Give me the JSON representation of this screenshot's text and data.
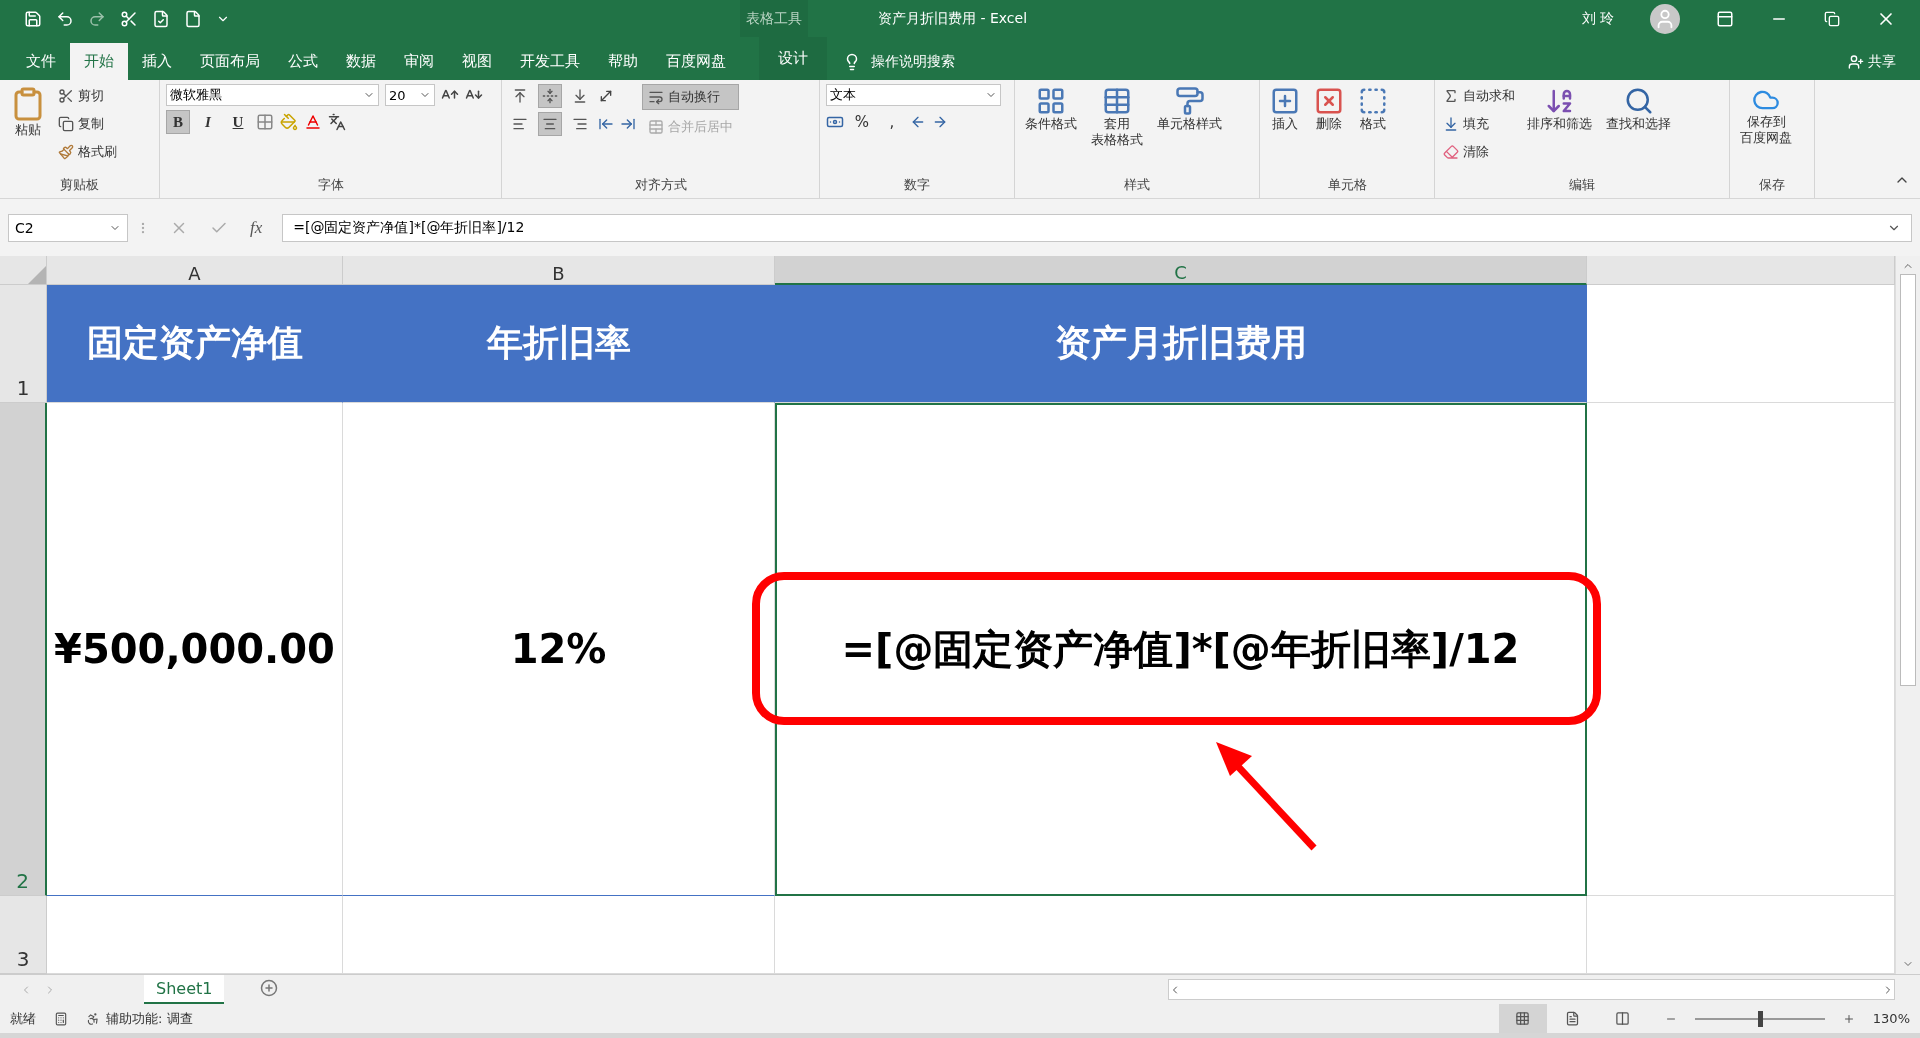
{
  "title_bar": {
    "context_group": "表格工具",
    "document_title": "资产月折旧费用 - Excel",
    "user": "刘 玲"
  },
  "menu_tabs": [
    {
      "label": "文件",
      "selected": false
    },
    {
      "label": "开始",
      "selected": true
    },
    {
      "label": "插入",
      "selected": false
    },
    {
      "label": "页面布局",
      "selected": false
    },
    {
      "label": "公式",
      "selected": false
    },
    {
      "label": "数据",
      "selected": false
    },
    {
      "label": "审阅",
      "selected": false
    },
    {
      "label": "视图",
      "selected": false
    },
    {
      "label": "开发工具",
      "selected": false
    },
    {
      "label": "帮助",
      "selected": false
    },
    {
      "label": "百度网盘",
      "selected": false
    }
  ],
  "context_tab": {
    "label": "设计",
    "selected": false
  },
  "tell_me": "操作说明搜索",
  "share": "共享",
  "ribbon": {
    "clipboard": {
      "label": "剪贴板",
      "paste": "粘贴",
      "cut": "剪切",
      "copy": "复制",
      "format_painter": "格式刷"
    },
    "font": {
      "label": "字体",
      "font_name": "微软雅黑",
      "font_size": "20",
      "styles": [
        {
          "label": "B",
          "selected": true
        },
        {
          "label": "I",
          "selected": false
        },
        {
          "label": "U",
          "selected": false
        }
      ]
    },
    "alignment": {
      "label": "对齐方式",
      "vertical": [
        {
          "kind": "top",
          "selected": false
        },
        {
          "kind": "middle",
          "selected": true
        },
        {
          "kind": "bottom",
          "selected": false
        }
      ],
      "horizontal": [
        {
          "kind": "left",
          "selected": false
        },
        {
          "kind": "center",
          "selected": true
        },
        {
          "kind": "right",
          "selected": false
        }
      ],
      "wrap_text": {
        "label": "自动换行",
        "selected": true
      },
      "merge": {
        "label": "合并后居中",
        "disabled": true
      }
    },
    "number": {
      "label": "数字",
      "format": "文本",
      "percent": "%",
      "comma": ","
    },
    "styles": {
      "label": "样式",
      "items": [
        {
          "lines": [
            "条件格式"
          ]
        },
        {
          "lines": [
            "套用",
            "表格格式"
          ]
        },
        {
          "lines": [
            "单元格样式"
          ]
        }
      ]
    },
    "cells": {
      "label": "单元格",
      "items": [
        "插入",
        "删除",
        "格式"
      ]
    },
    "editing": {
      "label": "编辑",
      "autosum": "自动求和",
      "fill": "填充",
      "clear": "清除",
      "sort": "排序和筛选",
      "find": "查找和选择"
    },
    "save": {
      "label": "保存",
      "lines": [
        "保存到",
        "百度网盘"
      ]
    }
  },
  "name_box": "C2",
  "fx": "fx",
  "formula": "=[@固定资产净值]*[@年折旧率]/12",
  "columns": [
    {
      "label": "A",
      "selected": false
    },
    {
      "label": "B",
      "selected": false
    },
    {
      "label": "C",
      "selected": true
    }
  ],
  "rows": [
    {
      "number": "1",
      "kind": "header",
      "selected": false,
      "cells": [
        "固定资产净值",
        "年折旧率",
        "资产月折旧费用"
      ]
    },
    {
      "number": "2",
      "kind": "data",
      "selected": true,
      "cells": [
        "¥500,000.00",
        "12%",
        "=[@固定资产净值]*[@年折旧率]/12"
      ]
    },
    {
      "number": "3",
      "kind": "blank",
      "selected": false
    }
  ],
  "sheets": [
    {
      "label": "Sheet1",
      "selected": true
    }
  ],
  "status_bar": {
    "ready": "就绪",
    "accessibility": "辅助功能: 调查",
    "views": [
      {
        "kind": "normal",
        "selected": true
      },
      {
        "kind": "page_layout",
        "selected": false
      },
      {
        "kind": "page_break",
        "selected": false
      }
    ],
    "zoom": {
      "level": 0.5,
      "reading": "130%"
    }
  }
}
